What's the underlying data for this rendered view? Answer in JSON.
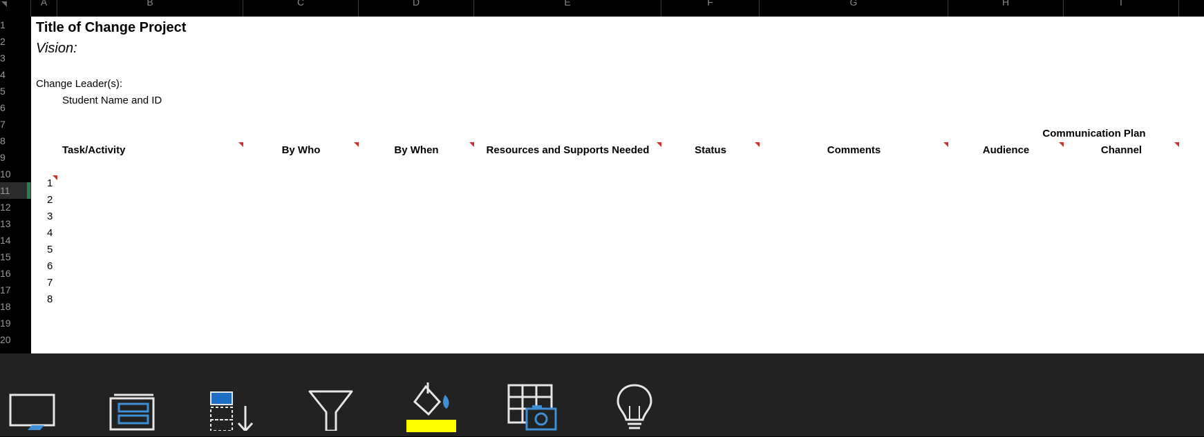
{
  "columns": [
    "A",
    "B",
    "C",
    "D",
    "E",
    "F",
    "G",
    "H",
    "I"
  ],
  "rows": [
    "1",
    "2",
    "3",
    "4",
    "5",
    "6",
    "7",
    "8",
    "9",
    "10",
    "11",
    "12",
    "13",
    "14",
    "15",
    "16",
    "17",
    "18",
    "19",
    "20"
  ],
  "active_row": "11",
  "sheet": {
    "title": "Title of Change Project",
    "vision_label": "Vision:",
    "change_leader_label": "Change Leader(s):",
    "student_name": "Student Name and ID",
    "comm_plan_label": "Communication Plan",
    "headers": {
      "task": "Task/Activity",
      "by_who": "By Who",
      "by_when": "By When",
      "resources": "Resources and Supports Needed",
      "status": "Status",
      "comments": "Comments",
      "audience": "Audience",
      "channel": "Channel"
    },
    "task_numbers": [
      "1",
      "2",
      "3",
      "4",
      "5",
      "6",
      "7",
      "8"
    ]
  },
  "toolbar": {
    "items": [
      "display-icon",
      "freeze-panes-icon",
      "sort-icon",
      "filter-icon",
      "fill-color-icon",
      "table-snapshot-icon",
      "lightbulb-icon"
    ]
  },
  "colors": {
    "accent_blue": "#3d8fd6",
    "fill_yellow": "#ffff00",
    "comment_red": "#d0312d",
    "selection_green": "#2e7d4f"
  }
}
